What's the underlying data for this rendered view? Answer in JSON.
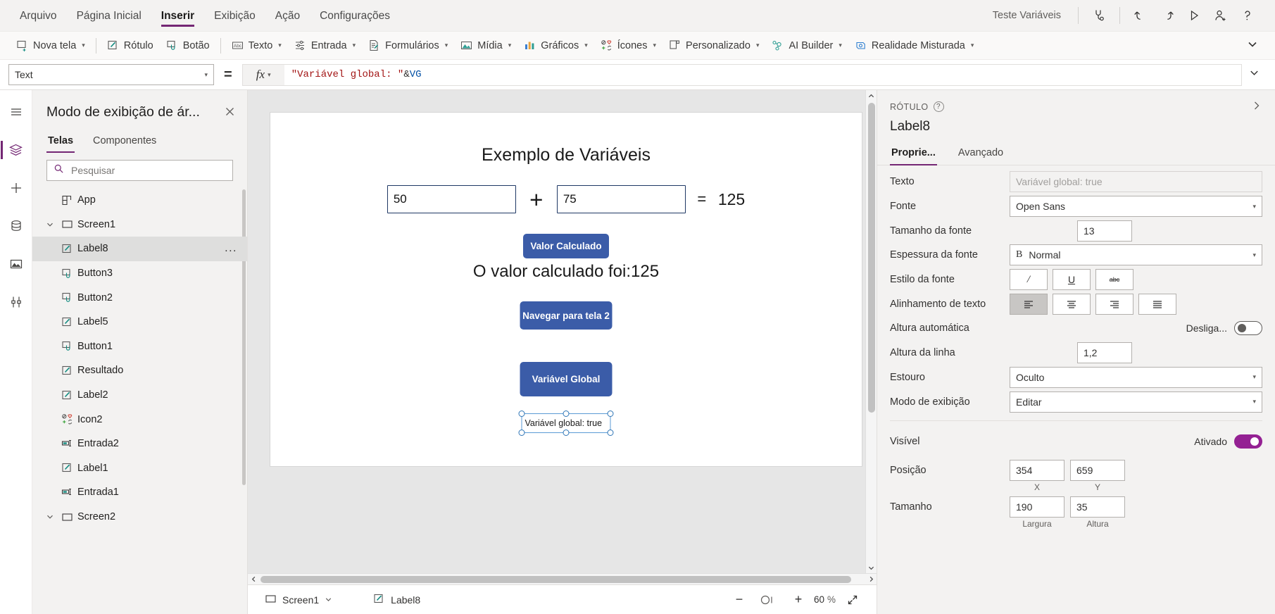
{
  "menubar": {
    "items": [
      {
        "label": "Arquivo",
        "active": false
      },
      {
        "label": "Página Inicial",
        "active": false
      },
      {
        "label": "Inserir",
        "active": true
      },
      {
        "label": "Exibição",
        "active": false
      },
      {
        "label": "Ação",
        "active": false
      },
      {
        "label": "Configurações",
        "active": false
      }
    ],
    "app_title": "Teste Variáveis",
    "icons": [
      "app-checker-icon",
      "undo-icon",
      "redo-icon",
      "preview-play-icon",
      "share-user-icon",
      "help-icon"
    ]
  },
  "ribbon": {
    "items": [
      {
        "label": "Nova tela",
        "icon": "new-screen-icon",
        "caret": true
      },
      {
        "label": "Rótulo",
        "icon": "label-icon",
        "caret": false
      },
      {
        "label": "Botão",
        "icon": "button-icon",
        "caret": false
      },
      {
        "label": "Texto",
        "icon": "text-abc-icon",
        "caret": true
      },
      {
        "label": "Entrada",
        "icon": "input-sliders-icon",
        "caret": true
      },
      {
        "label": "Formulários",
        "icon": "forms-icon",
        "caret": true
      },
      {
        "label": "Mídia",
        "icon": "media-image-icon",
        "caret": true
      },
      {
        "label": "Gráficos",
        "icon": "charts-icon",
        "caret": true
      },
      {
        "label": "Ícones",
        "icon": "icons-icon",
        "caret": true
      },
      {
        "label": "Personalizado",
        "icon": "custom-icon",
        "caret": true
      },
      {
        "label": "AI Builder",
        "icon": "ai-builder-icon",
        "caret": true
      },
      {
        "label": "Realidade Misturada",
        "icon": "mixed-reality-icon",
        "caret": true
      }
    ],
    "overflow": "chevron-down-icon"
  },
  "formula_bar": {
    "property": "Text",
    "equals": "=",
    "fx": "fx",
    "formula_parts": [
      {
        "text": "\"Variável global: \"",
        "kind": "string"
      },
      {
        "text": "&",
        "kind": "op"
      },
      {
        "text": "VG",
        "kind": "var"
      }
    ],
    "formula_full": "\"Variável global: \"&VG"
  },
  "rail": {
    "items": [
      {
        "name": "hamburger-menu-icon",
        "active": false
      },
      {
        "name": "tree-view-icon",
        "active": true
      },
      {
        "name": "insert-plus-icon",
        "active": false
      },
      {
        "name": "data-sources-icon",
        "active": false
      },
      {
        "name": "media-library-icon",
        "active": false
      },
      {
        "name": "advanced-tools-icon",
        "active": false
      }
    ]
  },
  "tree_panel": {
    "title": "Modo de exibição de ár...",
    "close_icon": "close-icon",
    "tabs": [
      {
        "label": "Telas",
        "active": true
      },
      {
        "label": "Componentes",
        "active": false
      }
    ],
    "search_placeholder": "Pesquisar",
    "search_value": "",
    "nodes": [
      {
        "label": "App",
        "icon": "app-icon",
        "level": 0,
        "chevron": false,
        "selected": false
      },
      {
        "label": "Screen1",
        "icon": "screen-icon",
        "level": 0,
        "chevron": true,
        "selected": false
      },
      {
        "label": "Label8",
        "icon": "label-icon",
        "level": 1,
        "chevron": false,
        "selected": true,
        "dots": "..."
      },
      {
        "label": "Button3",
        "icon": "button-icon",
        "level": 1,
        "chevron": false,
        "selected": false
      },
      {
        "label": "Button2",
        "icon": "button-icon",
        "level": 1,
        "chevron": false,
        "selected": false
      },
      {
        "label": "Label5",
        "icon": "label-icon",
        "level": 1,
        "chevron": false,
        "selected": false
      },
      {
        "label": "Button1",
        "icon": "button-icon",
        "level": 1,
        "chevron": false,
        "selected": false
      },
      {
        "label": "Resultado",
        "icon": "label-icon",
        "level": 1,
        "chevron": false,
        "selected": false
      },
      {
        "label": "Label2",
        "icon": "label-icon",
        "level": 1,
        "chevron": false,
        "selected": false
      },
      {
        "label": "Icon2",
        "icon": "icons-icon",
        "level": 1,
        "chevron": false,
        "selected": false
      },
      {
        "label": "Entrada2",
        "icon": "text-input-icon",
        "level": 1,
        "chevron": false,
        "selected": false
      },
      {
        "label": "Label1",
        "icon": "label-icon",
        "level": 1,
        "chevron": false,
        "selected": false
      },
      {
        "label": "Entrada1",
        "icon": "text-input-icon",
        "level": 1,
        "chevron": false,
        "selected": false
      },
      {
        "label": "Screen2",
        "icon": "screen-icon",
        "level": 0,
        "chevron": true,
        "selected": false
      }
    ]
  },
  "canvas": {
    "title": "Exemplo de Variáveis",
    "input_a": "50",
    "operator_plus": "+",
    "input_b": "75",
    "operator_equals": "=",
    "sum_value": "125",
    "btn_calc": "Valor Calculado",
    "result_text": "O valor calculado foi:125",
    "btn_nav": "Navegar para tela 2",
    "btn_global": "Variável Global",
    "selected_label_text": "Variável global: true"
  },
  "statusbar": {
    "screen_name": "Screen1",
    "screen_icon": "screen-icon",
    "screen_caret": "chevron-down-icon",
    "control_name": "Label8",
    "control_icon": "label-icon",
    "zoom_minus": "−",
    "zoom_plus": "+",
    "zoom_value": "60",
    "zoom_unit": "%",
    "fit_icon": "fit-screen-icon"
  },
  "properties": {
    "kicker": "RÓTULO",
    "help_icon": "help-circle-icon",
    "collapse_icon": "chevron-right-icon",
    "control_name": "Label8",
    "tabs": [
      {
        "label": "Proprie...",
        "active": true
      },
      {
        "label": "Avançado",
        "active": false
      }
    ],
    "rows": [
      {
        "label": "Texto",
        "type": "readonly",
        "value": "Variável global: true"
      },
      {
        "label": "Fonte",
        "type": "select",
        "value": "Open Sans"
      },
      {
        "label": "Tamanho da fonte",
        "type": "number",
        "value": "13"
      },
      {
        "label": "Espessura da fonte",
        "type": "select-bold",
        "value": "Normal",
        "prefix": "B"
      },
      {
        "label": "Estilo da fonte",
        "type": "segments-style",
        "segments": [
          "/",
          "U",
          "abc"
        ]
      },
      {
        "label": "Alinhamento de texto",
        "type": "segments-align",
        "segments": [
          "align-left",
          "align-center",
          "align-right",
          "align-justify"
        ],
        "active_index": 0
      },
      {
        "label": "Altura automática",
        "type": "toggle",
        "state_label": "Desliga...",
        "on": false
      },
      {
        "label": "Altura da linha",
        "type": "number",
        "value": "1,2"
      },
      {
        "label": "Estouro",
        "type": "select",
        "value": "Oculto"
      },
      {
        "label": "Modo de exibição",
        "type": "select",
        "value": "Editar"
      }
    ],
    "rows2": [
      {
        "label": "Visível",
        "type": "toggle",
        "state_label": "Ativado",
        "on": true
      },
      {
        "label": "Posição",
        "type": "pair",
        "v1": "354",
        "v2": "659",
        "s1": "X",
        "s2": "Y"
      },
      {
        "label": "Tamanho",
        "type": "pair",
        "v1": "190",
        "v2": "35",
        "s1": "Largura",
        "s2": "Altura"
      }
    ]
  }
}
